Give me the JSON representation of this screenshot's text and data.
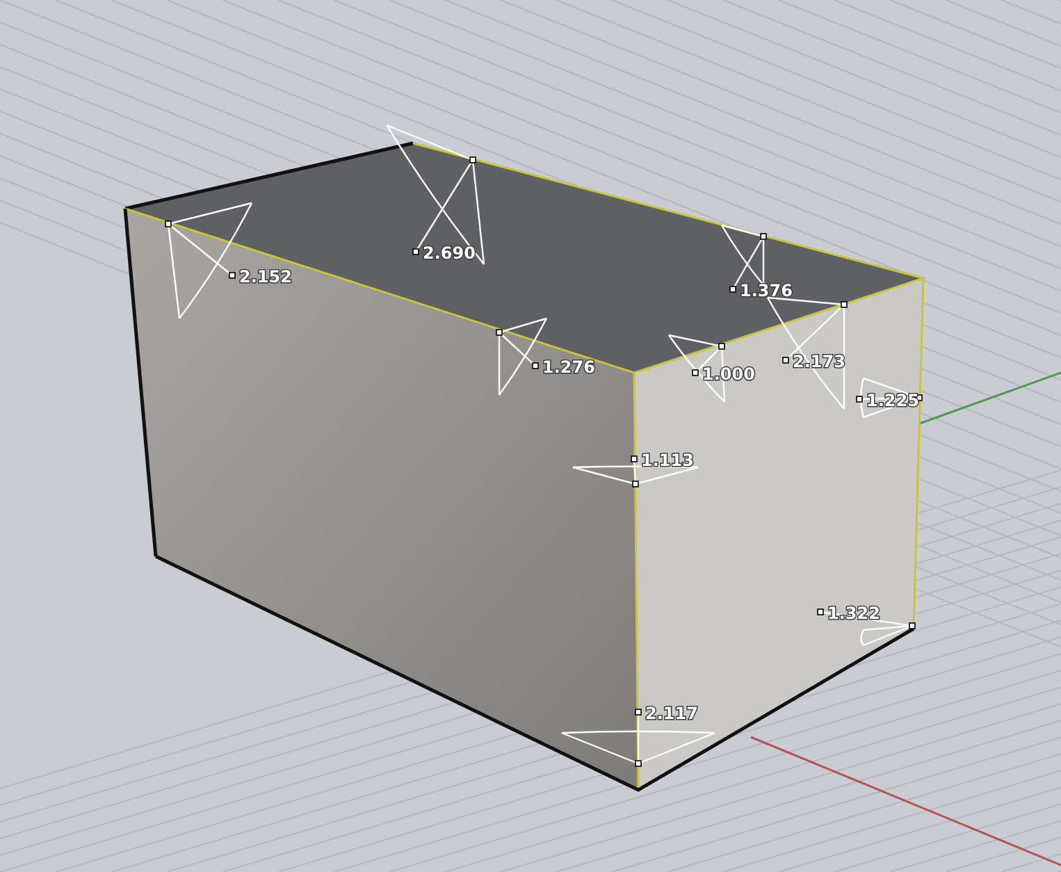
{
  "viewport": {
    "annotations": [
      {
        "text": "2.152"
      },
      {
        "text": "2.690"
      },
      {
        "text": "1.376"
      },
      {
        "text": "1.276"
      },
      {
        "text": "1.000"
      },
      {
        "text": "2.173"
      },
      {
        "text": "1.225"
      },
      {
        "text": "1.113"
      },
      {
        "text": "1.322"
      },
      {
        "text": "2.117"
      }
    ]
  }
}
